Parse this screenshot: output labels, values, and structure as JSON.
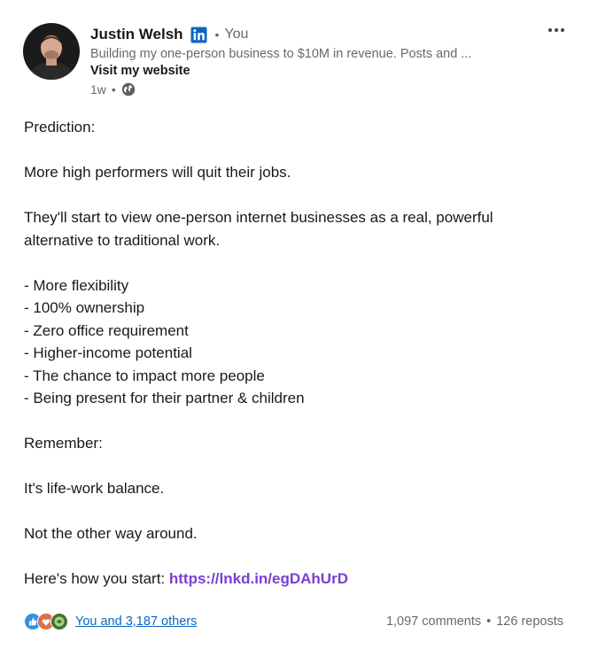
{
  "author": {
    "name": "Justin Welsh",
    "badge_icon": "linkedin-icon",
    "relation": "You",
    "headline": "Building my one-person business to $10M in revenue. Posts and ...",
    "website_label": "Visit my website",
    "time": "1w",
    "visibility_icon": "globe-icon"
  },
  "more_icon": "more-horizontal-icon",
  "post": {
    "intro": "Prediction:",
    "line1": "More high performers will quit their jobs.",
    "line2": "They'll start to view one-person internet businesses as a real, powerful alternative to traditional work.",
    "bullets": [
      "- More flexibility",
      "- 100% ownership",
      "- Zero office requirement",
      "- Higher-income potential",
      "- The chance to impact more people",
      "- Being present for their partner & children"
    ],
    "remember": "Remember:",
    "balance": "It's life-work balance.",
    "not_other": "Not the other way around.",
    "cta_text": "Here's how you start: ",
    "cta_link": "https://lnkd.in/egDAhUrD"
  },
  "social": {
    "reaction_icons": [
      "like-icon",
      "love-icon",
      "support-icon"
    ],
    "reactions_label": "You and 3,187 others",
    "comments": "1,097 comments",
    "reposts": "126 reposts"
  },
  "colors": {
    "link": "#7b3fd3",
    "linkedin_blue": "#0a66c2",
    "muted_text": "#666666"
  }
}
